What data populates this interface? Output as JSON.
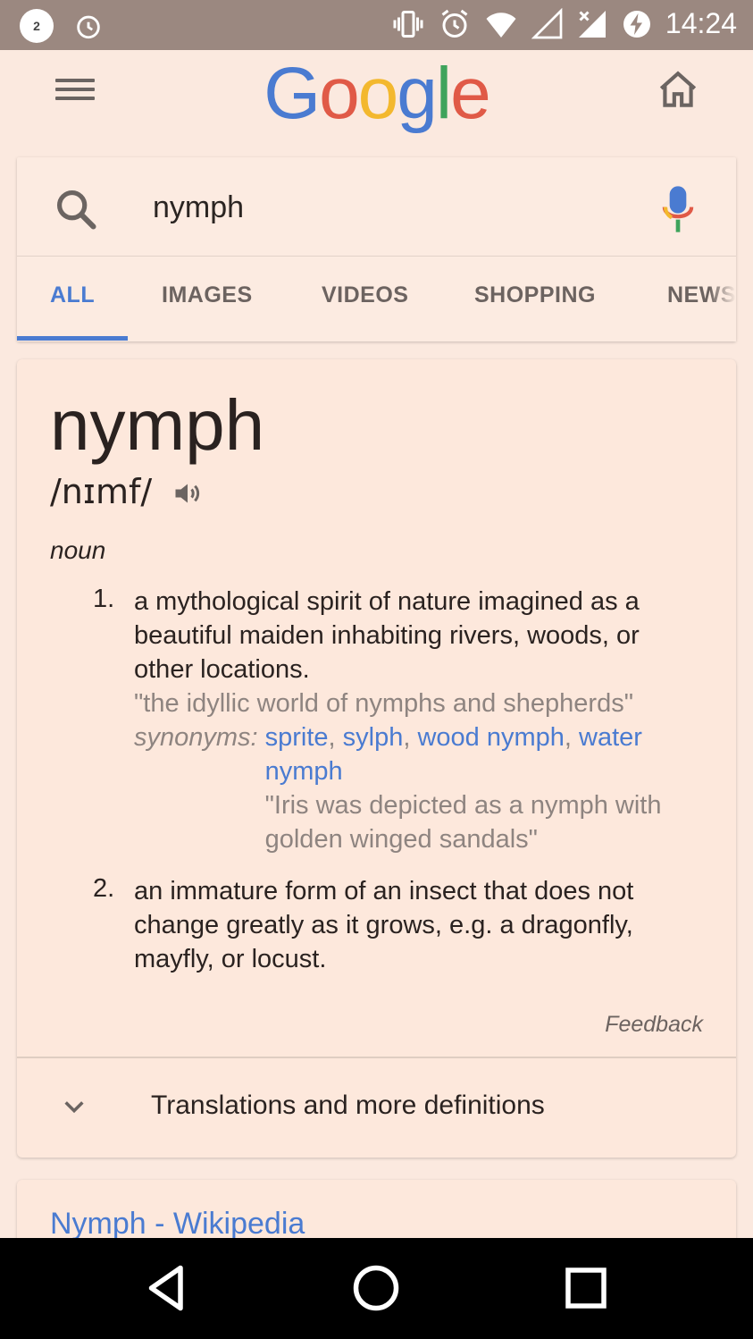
{
  "status_bar": {
    "notification_count": "2",
    "time": "14:24"
  },
  "header": {
    "logo_letters": [
      {
        "char": "G",
        "color": "#4a7bd1"
      },
      {
        "char": "o",
        "color": "#e05a47"
      },
      {
        "char": "o",
        "color": "#f3b82e"
      },
      {
        "char": "g",
        "color": "#4a7bd1"
      },
      {
        "char": "l",
        "color": "#3ea35b"
      },
      {
        "char": "e",
        "color": "#e05a47"
      }
    ]
  },
  "search": {
    "query": "nymph",
    "tabs": [
      {
        "label": "ALL"
      },
      {
        "label": "IMAGES"
      },
      {
        "label": "VIDEOS"
      },
      {
        "label": "SHOPPING"
      },
      {
        "label": "NEWS"
      }
    ]
  },
  "definition": {
    "word": "nymph",
    "phonetic": "/nɪmf/",
    "part_of_speech": "noun",
    "senses": [
      {
        "number": "1.",
        "text": "a mythological spirit of nature imagined as a beautiful maiden inhabiting rivers, woods, or other locations.",
        "example": "\"the idyllic world of nymphs and shepherds\"",
        "synonyms_label": "synonyms:",
        "synonyms": [
          "sprite",
          "sylph",
          "wood nymph",
          "water nymph"
        ],
        "synonym_example": "\"Iris was depicted as a nymph with golden winged sandals\""
      },
      {
        "number": "2.",
        "text": "an immature form of an insect that does not change greatly as it grows, e.g. a dragonfly, mayfly, or locust."
      }
    ],
    "feedback_label": "Feedback",
    "more_label": "Translations and more definitions"
  },
  "result": {
    "title": "Nymph - Wikipedia"
  }
}
